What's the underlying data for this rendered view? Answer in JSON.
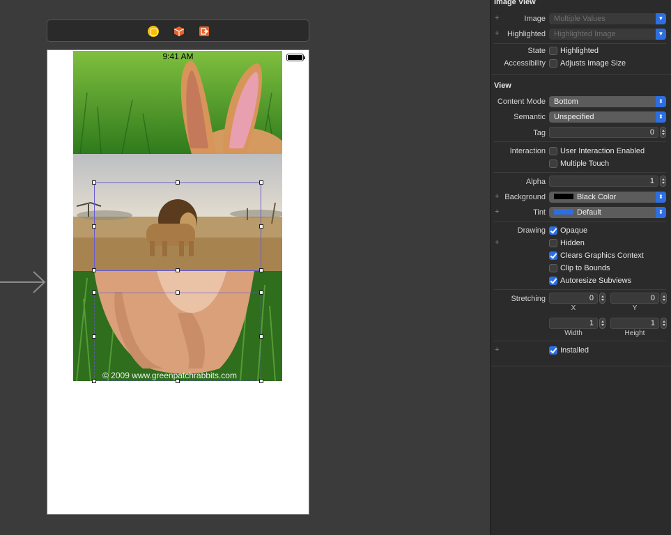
{
  "canvas": {
    "status_time": "9:41 AM",
    "watermark": "© 2009 www.greenpatchrabbits.com",
    "scene_icons": [
      "view-controller-icon",
      "first-responder-icon",
      "exit-icon"
    ]
  },
  "inspector": {
    "image_view": {
      "title": "Image View",
      "image_label": "Image",
      "image_value": "Multiple Values",
      "highlighted_label": "Highlighted",
      "highlighted_value": "Highlighted Image",
      "state_label": "State",
      "state_checkbox": "Highlighted",
      "accessibility_label": "Accessibility",
      "accessibility_checkbox": "Adjusts Image Size"
    },
    "view": {
      "title": "View",
      "content_mode_label": "Content Mode",
      "content_mode_value": "Bottom",
      "semantic_label": "Semantic",
      "semantic_value": "Unspecified",
      "tag_label": "Tag",
      "tag_value": "0",
      "interaction_label": "Interaction",
      "user_interaction": "User Interaction Enabled",
      "multiple_touch": "Multiple Touch",
      "alpha_label": "Alpha",
      "alpha_value": "1",
      "background_label": "Background",
      "background_value": "Black Color",
      "background_color": "#000000",
      "tint_label": "Tint",
      "tint_value": "Default",
      "tint_color": "#2d6ee0",
      "drawing_label": "Drawing",
      "opaque": "Opaque",
      "hidden": "Hidden",
      "clears_graphics": "Clears Graphics Context",
      "clip_to_bounds": "Clip to Bounds",
      "autoresize": "Autoresize Subviews",
      "stretching_label": "Stretching",
      "stretch_x": "0",
      "stretch_y": "0",
      "stretch_width": "1",
      "stretch_height": "1",
      "x_label": "X",
      "y_label": "Y",
      "width_label": "Width",
      "height_label": "Height",
      "installed": "Installed"
    }
  },
  "colors": {
    "accent": "#2d6ee0",
    "selection": "#6a5acd"
  }
}
